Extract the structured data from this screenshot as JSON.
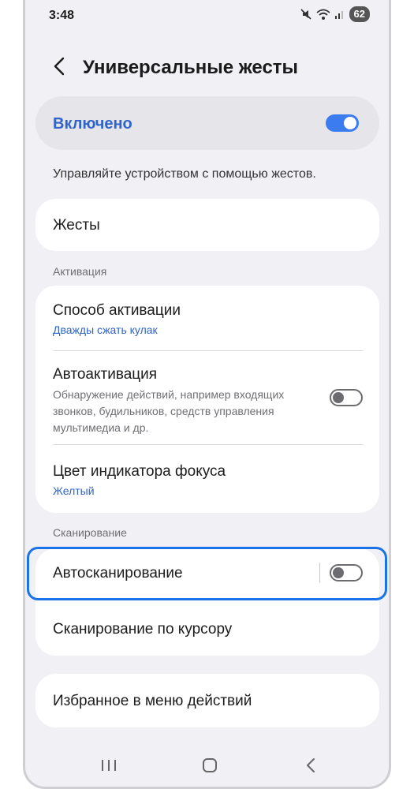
{
  "status_bar": {
    "time": "3:48",
    "battery": "62",
    "icons": [
      "mute-icon",
      "wifi-icon",
      "signal-icon",
      "battery-icon"
    ]
  },
  "header": {
    "title": "Универсальные жесты",
    "back_icon": "back-arrow-icon"
  },
  "master_switch": {
    "label": "Включено",
    "state": true
  },
  "description": "Управляйте устройством с помощью жестов.",
  "gestures_item": {
    "title": "Жесты"
  },
  "activation_section": {
    "label": "Активация",
    "items": [
      {
        "title": "Способ активации",
        "value": "Дважды сжать кулак"
      },
      {
        "title": "Автоактивация",
        "description": "Обнаружение действий, например входящих звонков, будильников, средств управления мультимедиа и др.",
        "toggle": false
      },
      {
        "title": "Цвет индикатора фокуса",
        "value": "Желтый"
      }
    ]
  },
  "scanning_section": {
    "label": "Сканирование",
    "items": [
      {
        "title": "Автосканирование",
        "toggle": false
      },
      {
        "title": "Сканирование по курсору"
      }
    ]
  },
  "favorites_item": {
    "title": "Избранное в меню действий"
  },
  "nav_bar": {
    "buttons": [
      "recents-icon",
      "home-icon",
      "back-icon"
    ]
  },
  "colors": {
    "accent": "#2f64c8",
    "toggle_on": "#3b7cf0",
    "highlight": "#1a73e8",
    "background": "#f1f0f5"
  }
}
